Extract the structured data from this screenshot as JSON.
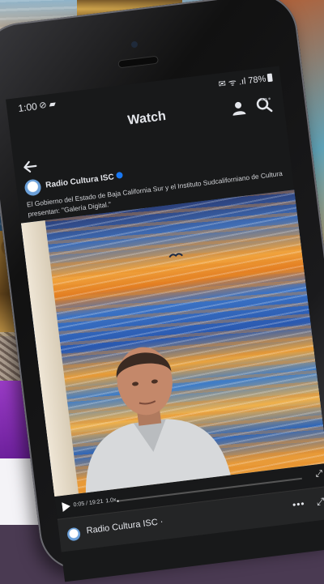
{
  "status_bar": {
    "time": "1:00",
    "left_icons": "⊘ ▰",
    "right_icons": "✉ ᯤ .ıl",
    "battery": "78%"
  },
  "header": {
    "title": "Watch"
  },
  "post": {
    "page_name": "Radio Cultura ISC",
    "text": "El Gobierno del Estado de Baja California Sur y el Instituto Sudcaliforniano de Cultura presentan: \"Galería Digital.\""
  },
  "video": {
    "time": "0:05 / 19:21",
    "speed": "1.0x",
    "progress": 0.004
  },
  "bottom_bar": {
    "page_name": "Radio Cultura ISC · ",
    "more": "•••",
    "collapse": "⤢"
  },
  "icons": [
    "back-arrow-icon",
    "profile-icon",
    "search-icon",
    "verified-icon",
    "settings-icon",
    "play-icon",
    "fullscreen-icon"
  ]
}
